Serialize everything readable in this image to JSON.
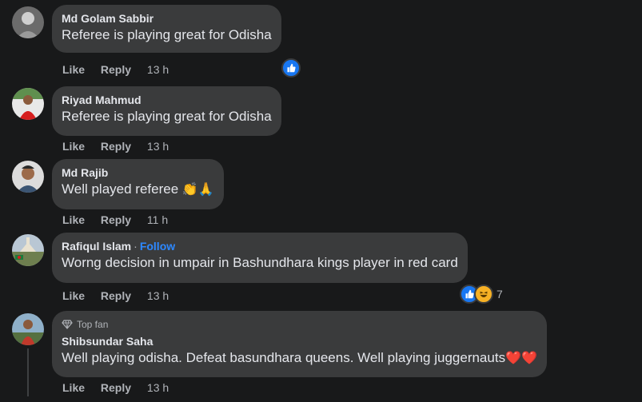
{
  "comments": [
    {
      "author": "Md Golam Sabbir",
      "text": "Referee is playing great for Odisha",
      "like": "Like",
      "reply": "Reply",
      "time": "13 h",
      "reactions": {
        "types": [
          "like"
        ],
        "count": ""
      }
    },
    {
      "author": "Riyad Mahmud",
      "text": "Referee is playing great for Odisha",
      "like": "Like",
      "reply": "Reply",
      "time": "13 h"
    },
    {
      "author": "Md Rajib",
      "text": "Well played referee",
      "emoji": "👏🙏",
      "like": "Like",
      "reply": "Reply",
      "time": "11 h"
    },
    {
      "author": "Rafiqul Islam",
      "follow": "Follow",
      "text": "Worng decision in umpair in Bashundhara kings player in red card",
      "like": "Like",
      "reply": "Reply",
      "time": "13 h",
      "reactions": {
        "types": [
          "like",
          "haha"
        ],
        "count": "7"
      }
    },
    {
      "badge": "Top fan",
      "author": "Shibsundar Saha",
      "text": "Well playing odisha. Defeat basundhara queens. Well playing juggernauts",
      "emoji": "❤️❤️",
      "like": "Like",
      "reply": "Reply",
      "time": "13 h"
    }
  ],
  "colors": {
    "background": "#18191a",
    "bubble": "#3a3b3c",
    "primary_text": "#e4e6eb",
    "secondary_text": "#b0b3b8",
    "link": "#2d88ff",
    "like_blue": "#1877f2"
  }
}
